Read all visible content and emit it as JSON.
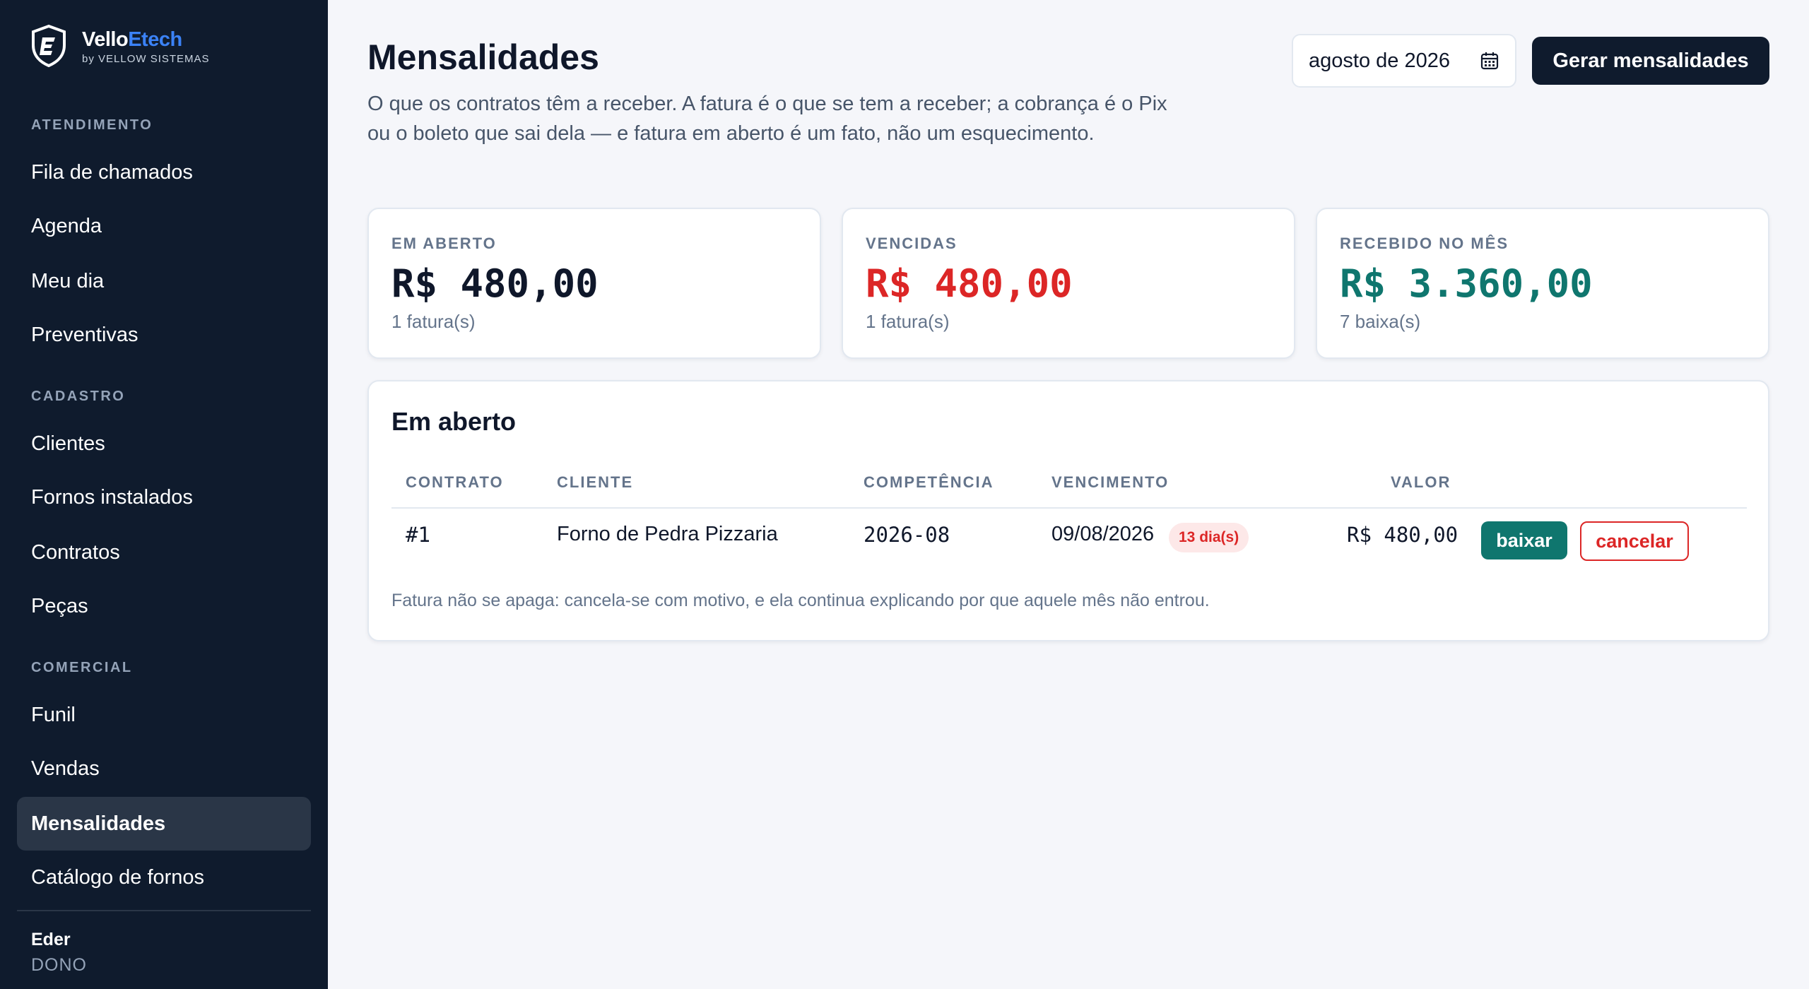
{
  "brand": {
    "name_part1": "Vello",
    "name_part2": "Etech",
    "subtitle": "by VELLOW SISTEMAS",
    "logo_icon": "shield-e-icon",
    "accent": "#3b82f6"
  },
  "sidebar": {
    "sections": [
      {
        "title": "ATENDIMENTO",
        "items": [
          "Fila de chamados",
          "Agenda",
          "Meu dia",
          "Preventivas"
        ]
      },
      {
        "title": "CADASTRO",
        "items": [
          "Clientes",
          "Fornos instalados",
          "Contratos",
          "Peças"
        ]
      },
      {
        "title": "COMERCIAL",
        "items": [
          "Funil",
          "Vendas",
          "Mensalidades",
          "Catálogo de fornos"
        ]
      }
    ],
    "active_item": "Mensalidades",
    "user": {
      "name": "Eder",
      "role": "DONO"
    }
  },
  "header": {
    "title": "Mensalidades",
    "description": "O que os contratos têm a receber. A fatura é o que se tem a receber; a cobrança é o Pix ou o boleto que sai dela — e fatura em aberto é um fato, não um esquecimento.",
    "month": "agosto de 2026",
    "month_icon": "calendar-icon",
    "generate_label": "Gerar mensalidades"
  },
  "stats": [
    {
      "label": "EM ABERTO",
      "value": "R$ 480,00",
      "sub": "1 fatura(s)",
      "color": "#0f172a"
    },
    {
      "label": "VENCIDAS",
      "value": "R$ 480,00",
      "sub": "1 fatura(s)",
      "color": "#dc2626"
    },
    {
      "label": "RECEBIDO NO MÊS",
      "value": "R$ 3.360,00",
      "sub": "7 baixa(s)",
      "color": "#0f766e"
    }
  ],
  "open_invoices": {
    "title": "Em aberto",
    "columns": [
      "CONTRATO",
      "CLIENTE",
      "COMPETÊNCIA",
      "VENCIMENTO",
      "VALOR"
    ],
    "rows": [
      {
        "contract": "#1",
        "client": "Forno de Pedra Pizzaria",
        "competence": "2026-08",
        "due": "09/08/2026",
        "overdue_badge": "13 dia(s)",
        "value": "R$ 480,00",
        "pay_label": "baixar",
        "cancel_label": "cancelar"
      }
    ],
    "note": "Fatura não se apaga: cancela-se com motivo, e ela continua explicando por que aquele mês não entrou."
  }
}
